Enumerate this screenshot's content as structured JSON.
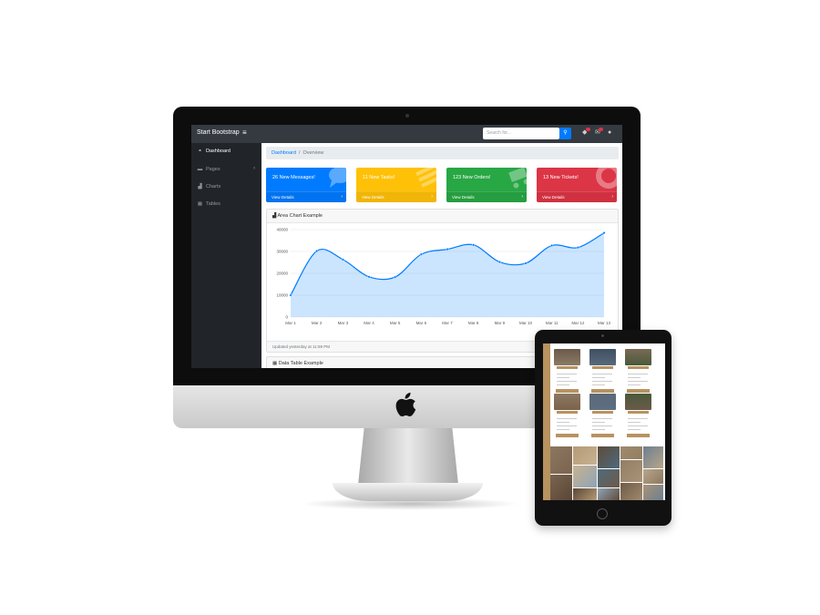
{
  "navbar": {
    "brand": "Start Bootstrap",
    "search_placeholder": "Search for..."
  },
  "sidebar": {
    "items": [
      {
        "label": "Dashboard",
        "icon": "dashboard-icon",
        "active": true
      },
      {
        "label": "Pages",
        "icon": "folder-icon",
        "has_submenu": true
      },
      {
        "label": "Charts",
        "icon": "area-chart-icon"
      },
      {
        "label": "Tables",
        "icon": "table-icon"
      }
    ]
  },
  "breadcrumb": {
    "link": "Dashboard",
    "separator": "/",
    "current": "Overview"
  },
  "cards": [
    {
      "title": "26 New Messages!",
      "link": "View Details",
      "color": "#007bff",
      "icon": "comments-icon"
    },
    {
      "title": "11 New Tasks!",
      "link": "View Details",
      "color": "#ffc107",
      "icon": "list-icon"
    },
    {
      "title": "123 New Orders!",
      "link": "View Details",
      "color": "#28a745",
      "icon": "shopping-cart-icon"
    },
    {
      "title": "13 New Tickets!",
      "link": "View Details",
      "color": "#dc3545",
      "icon": "life-ring-icon"
    }
  ],
  "area_chart": {
    "title": "Area Chart Example",
    "updated": "Updated yesterday at 11:59 PM"
  },
  "data_table": {
    "title": "Data Table Example"
  },
  "chart_data": {
    "type": "area",
    "x": [
      "Mar 1",
      "Mar 2",
      "Mar 3",
      "Mar 4",
      "Mar 5",
      "Mar 6",
      "Mar 7",
      "Mar 8",
      "Mar 9",
      "Mar 10",
      "Mar 11",
      "Mar 12",
      "Mar 13"
    ],
    "series": [
      {
        "values": [
          10000,
          30200,
          26300,
          18400,
          18300,
          28700,
          31000,
          33000,
          25200,
          24600,
          32700,
          31800,
          38500
        ],
        "color": "#007bff"
      }
    ],
    "yticks": [
      0,
      10000,
      20000,
      30000,
      40000
    ],
    "ylim": [
      0,
      40000
    ],
    "grid": true,
    "xlabel": "",
    "ylabel": ""
  }
}
